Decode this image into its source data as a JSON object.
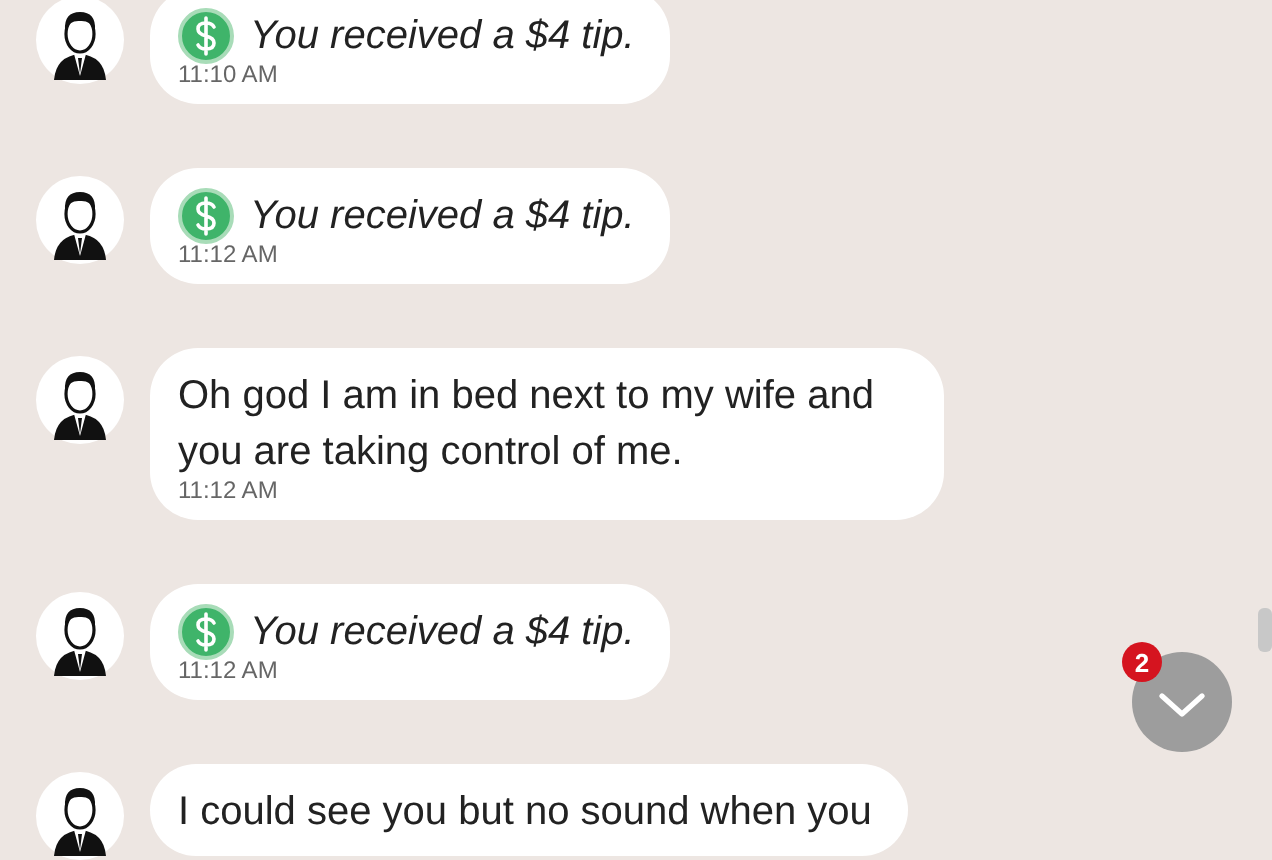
{
  "messages": [
    {
      "kind": "tip",
      "text": "You received a $4 tip.",
      "time": "11:10 AM"
    },
    {
      "kind": "tip",
      "text": "You received a $4 tip.",
      "time": "11:12 AM"
    },
    {
      "kind": "text",
      "text": "Oh god I am in bed next to my wife and you are taking control of me.",
      "time": "11:12 AM"
    },
    {
      "kind": "tip",
      "text": "You received a $4 tip.",
      "time": "11:12 AM"
    },
    {
      "kind": "text",
      "text": "I could see you but no sound when you"
    }
  ],
  "scroll_button": {
    "unread_count": "2"
  }
}
